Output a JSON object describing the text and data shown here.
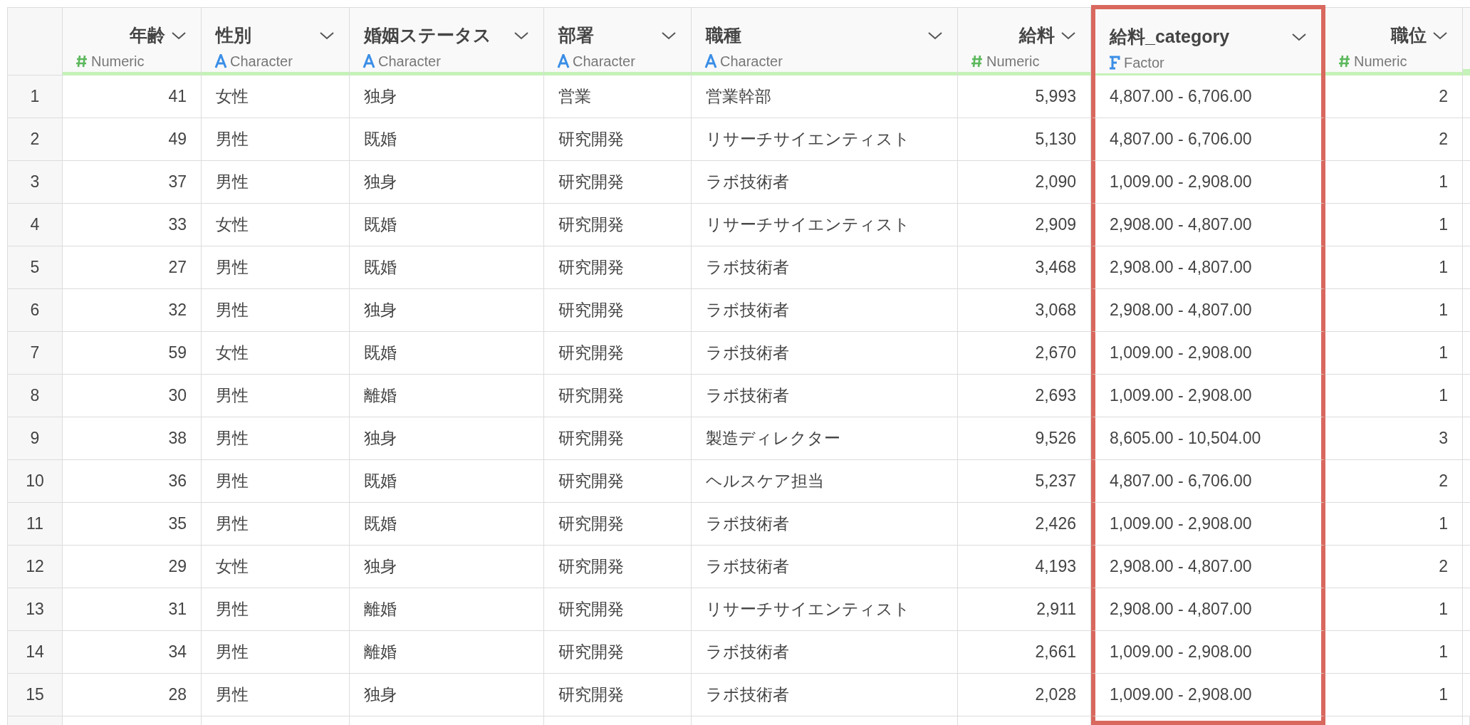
{
  "table": {
    "columns": [
      {
        "name": "年齢",
        "type": "Numeric",
        "kind": "numeric",
        "highlighted": false
      },
      {
        "name": "性別",
        "type": "Character",
        "kind": "character",
        "highlighted": false
      },
      {
        "name": "婚姻ステータス",
        "type": "Character",
        "kind": "character",
        "highlighted": false
      },
      {
        "name": "部署",
        "type": "Character",
        "kind": "character",
        "highlighted": false
      },
      {
        "name": "職種",
        "type": "Character",
        "kind": "character",
        "highlighted": false
      },
      {
        "name": "給料",
        "type": "Numeric",
        "kind": "numeric",
        "highlighted": false
      },
      {
        "name": "給料_category",
        "type": "Factor",
        "kind": "factor",
        "highlighted": true
      },
      {
        "name": "職位",
        "type": "Numeric",
        "kind": "numeric",
        "highlighted": false
      }
    ],
    "rows": [
      {
        "index": "1",
        "cells": [
          "41",
          "女性",
          "独身",
          "営業",
          "営業幹部",
          "5,993",
          "4,807.00 - 6,706.00",
          "2"
        ]
      },
      {
        "index": "2",
        "cells": [
          "49",
          "男性",
          "既婚",
          "研究開発",
          "リサーチサイエンティスト",
          "5,130",
          "4,807.00 - 6,706.00",
          "2"
        ]
      },
      {
        "index": "3",
        "cells": [
          "37",
          "男性",
          "独身",
          "研究開発",
          "ラボ技術者",
          "2,090",
          "1,009.00 - 2,908.00",
          "1"
        ]
      },
      {
        "index": "4",
        "cells": [
          "33",
          "女性",
          "既婚",
          "研究開発",
          "リサーチサイエンティスト",
          "2,909",
          "2,908.00 - 4,807.00",
          "1"
        ]
      },
      {
        "index": "5",
        "cells": [
          "27",
          "男性",
          "既婚",
          "研究開発",
          "ラボ技術者",
          "3,468",
          "2,908.00 - 4,807.00",
          "1"
        ]
      },
      {
        "index": "6",
        "cells": [
          "32",
          "男性",
          "独身",
          "研究開発",
          "ラボ技術者",
          "3,068",
          "2,908.00 - 4,807.00",
          "1"
        ]
      },
      {
        "index": "7",
        "cells": [
          "59",
          "女性",
          "既婚",
          "研究開発",
          "ラボ技術者",
          "2,670",
          "1,009.00 - 2,908.00",
          "1"
        ]
      },
      {
        "index": "8",
        "cells": [
          "30",
          "男性",
          "離婚",
          "研究開発",
          "ラボ技術者",
          "2,693",
          "1,009.00 - 2,908.00",
          "1"
        ]
      },
      {
        "index": "9",
        "cells": [
          "38",
          "男性",
          "独身",
          "研究開発",
          "製造ディレクター",
          "9,526",
          "8,605.00 - 10,504.00",
          "3"
        ]
      },
      {
        "index": "10",
        "cells": [
          "36",
          "男性",
          "既婚",
          "研究開発",
          "ヘルスケア担当",
          "5,237",
          "4,807.00 - 6,706.00",
          "2"
        ]
      },
      {
        "index": "11",
        "cells": [
          "35",
          "男性",
          "既婚",
          "研究開発",
          "ラボ技術者",
          "2,426",
          "1,009.00 - 2,908.00",
          "1"
        ]
      },
      {
        "index": "12",
        "cells": [
          "29",
          "女性",
          "独身",
          "研究開発",
          "ラボ技術者",
          "4,193",
          "2,908.00 - 4,807.00",
          "2"
        ]
      },
      {
        "index": "13",
        "cells": [
          "31",
          "男性",
          "離婚",
          "研究開発",
          "リサーチサイエンティスト",
          "2,911",
          "2,908.00 - 4,807.00",
          "1"
        ]
      },
      {
        "index": "14",
        "cells": [
          "34",
          "男性",
          "離婚",
          "研究開発",
          "ラボ技術者",
          "2,661",
          "1,009.00 - 2,908.00",
          "1"
        ]
      },
      {
        "index": "15",
        "cells": [
          "28",
          "男性",
          "独身",
          "研究開発",
          "ラボ技術者",
          "2,028",
          "1,009.00 - 2,908.00",
          "1"
        ]
      }
    ]
  }
}
